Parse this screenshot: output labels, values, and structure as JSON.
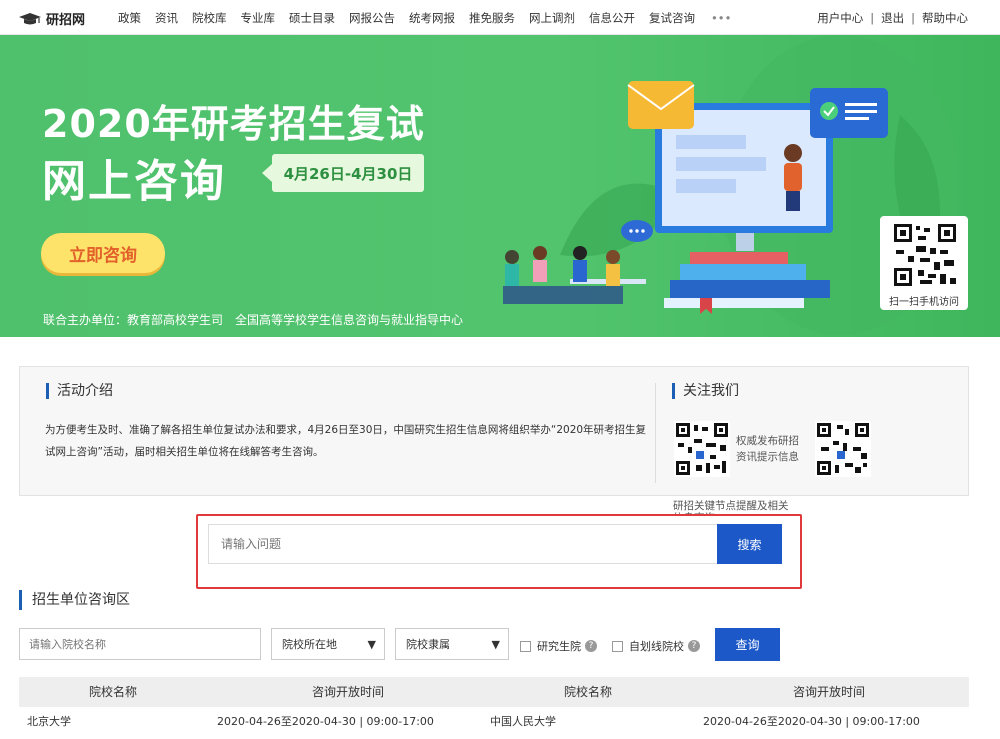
{
  "nav": {
    "logo": "研招网",
    "items": [
      "政策",
      "资讯",
      "院校库",
      "专业库",
      "硕士目录",
      "网报公告",
      "统考网报",
      "推免服务",
      "网上调剂",
      "信息公开",
      "复试咨询",
      "•••"
    ],
    "user_center": "用户中心",
    "logout": "退出",
    "help": "帮助中心",
    "separator": "|"
  },
  "banner": {
    "title_line1": "2020年研考招生复试",
    "title_line2": "网上咨询",
    "date_range": "4月26日-4月30日",
    "consult_button": "立即咨询",
    "organizers_label": "联合主办单位：教育部高校学生司",
    "organizer2": "全国高等学校学生信息咨询与就业指导中心",
    "qr_caption": "扫一扫手机访问"
  },
  "activity": {
    "heading": "活动介绍",
    "text": "为方便考生及时、准确了解各招生单位复试办法和要求，4月26日至30日，中国研究生招生信息网将组织举办“2020年研考招生复试网上咨询”活动，届时相关招生单位将在线解答考生咨询。"
  },
  "follow": {
    "heading": "关注我们",
    "qr1_caption": "权威发布研招资讯提示信息",
    "qr2_caption": "研招关键节点提醒及相关信息查询"
  },
  "search": {
    "placeholder": "请输入问题",
    "button": "搜索"
  },
  "region": {
    "heading": "招生单位咨询区",
    "school_placeholder": "请输入院校名称",
    "location_select": "院校所在地",
    "affiliation_select": "院校隶属",
    "checkbox_graduate_school": "研究生院",
    "checkbox_self_line": "自划线院校",
    "query_button": "查询"
  },
  "table": {
    "headers": [
      "院校名称",
      "咨询开放时间",
      "院校名称",
      "咨询开放时间"
    ],
    "rows": [
      [
        "北京大学",
        "2020-04-26至2020-04-30 | 09:00-17:00",
        "中国人民大学",
        "2020-04-26至2020-04-30 | 09:00-17:00"
      ]
    ]
  }
}
